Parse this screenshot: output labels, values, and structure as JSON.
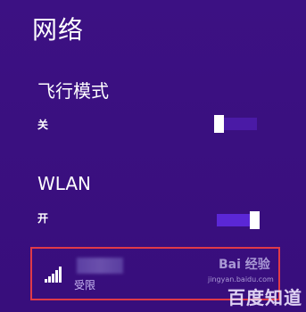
{
  "panel": {
    "title": "网络"
  },
  "airplane": {
    "title": "飞行模式",
    "state_label": "关",
    "is_on": false
  },
  "wlan": {
    "title": "WLAN",
    "state_label": "开",
    "is_on": true
  },
  "network": {
    "status": "受限",
    "signal_bars": 5,
    "highlight_color": "#e03a48"
  },
  "watermark": {
    "brand": "Bai 经验",
    "url": "jingyan.baidu.com",
    "big": "百度知道"
  },
  "colors": {
    "background": "#3a0f80",
    "toggle_on": "#5b27d6",
    "toggle_off": "#4a1aa6"
  }
}
